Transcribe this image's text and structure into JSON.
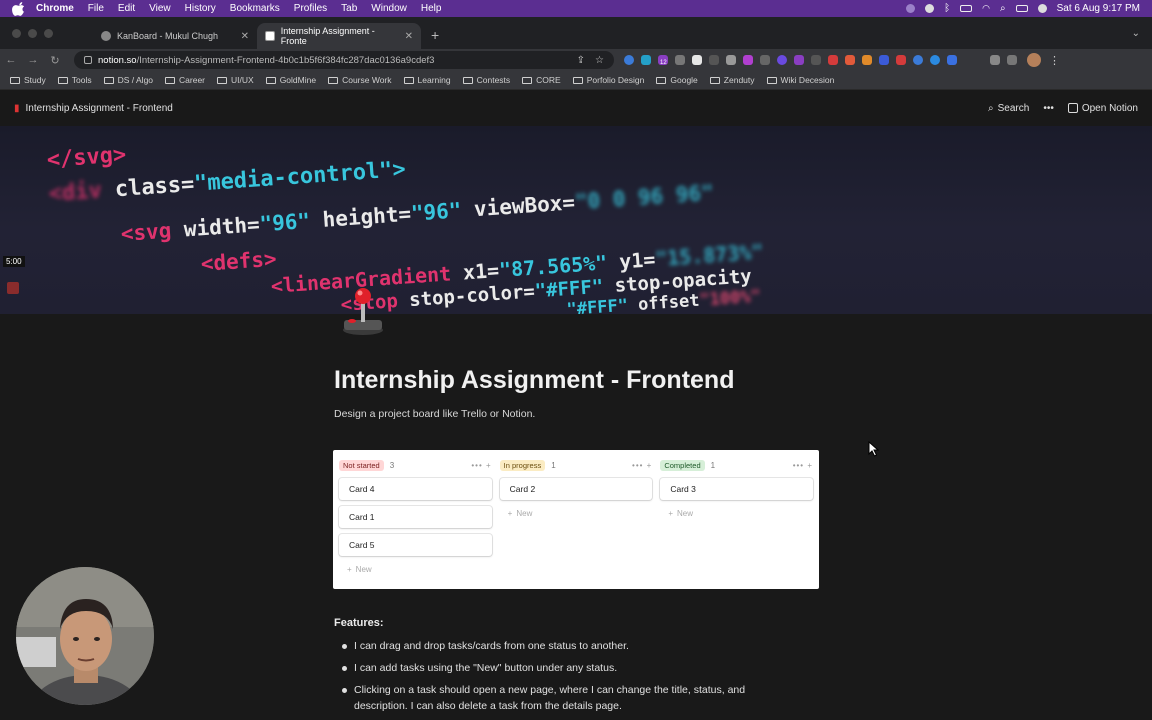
{
  "macos_menubar": {
    "app": "Chrome",
    "items": [
      "File",
      "Edit",
      "View",
      "History",
      "Bookmarks",
      "Profiles",
      "Tab",
      "Window",
      "Help"
    ],
    "datetime": "Sat 6 Aug  9:17 PM"
  },
  "browser": {
    "tabs": [
      {
        "title": "KanBoard - Mukul Chugh",
        "active": false
      },
      {
        "title": "Internship Assignment - Fronte",
        "active": true
      }
    ],
    "url_domain": "notion.so",
    "url_path": "/Internship-Assignment-Frontend-4b0c1b5f6f384fc287dac0136a9cdef3",
    "extension_badge": "12",
    "bookmarks": [
      "Study",
      "Tools",
      "DS / Algo",
      "Career",
      "UI/UX",
      "GoldMine",
      "Course Work",
      "Learning",
      "Contests",
      "CORE",
      "Porfolio Design",
      "Google",
      "Zenduty",
      "Wiki Decesion"
    ]
  },
  "notion_header": {
    "breadcrumb": "Internship Assignment - Frontend",
    "search_label": "Search",
    "more_label": "•••",
    "open_label": "Open Notion"
  },
  "cover_code": {
    "line1": "</svg>",
    "line2a": "<div",
    "line2b": " class=",
    "line2c": "\"media-control\">",
    "line3a": "<svg",
    "line3b": " width=",
    "line3c": "\"96\"",
    "line3d": " height=",
    "line3e": "\"96\"",
    "line3f": " viewBox=",
    "line3g": "\"0 0 96 96\"",
    "line4": "<defs>",
    "line5a": "<linearGradient",
    "line5b": " x1=",
    "line5c": "\"87.565%\"",
    "line5d": " y1=",
    "line5e": "\"15.873%\"",
    "line6a": "<stop",
    "line6b": " stop-color=",
    "line6c": "\"#FFF\"",
    "line6d": " stop-opacity",
    "line7a": "\"#FFF\"",
    "line7b": " offset",
    "line7c": "\"100%\""
  },
  "recording": {
    "timer": "5:00"
  },
  "page": {
    "title": "Internship Assignment - Frontend",
    "description": "Design a project board like Trello or Notion.",
    "board": {
      "columns": [
        {
          "status": "Not started",
          "count": "3",
          "color": "#ffd6d6",
          "cards": [
            "Card 4",
            "Card 1",
            "Card 5"
          ],
          "new_label": "New"
        },
        {
          "status": "In progress",
          "count": "1",
          "color": "#fbecc3",
          "cards": [
            "Card 2"
          ],
          "new_label": "New"
        },
        {
          "status": "Completed",
          "count": "1",
          "color": "#d6efd8",
          "cards": [
            "Card 3"
          ],
          "new_label": "New"
        }
      ],
      "actions_label": "•••",
      "add_label": "+"
    },
    "features_heading": "Features:",
    "features": [
      "I can drag and drop tasks/cards from one status to another.",
      "I can add tasks using the \"New\" button under any status.",
      "Clicking on a task should open a new page, where I can change the title, status, and description. I can also delete a task from the details page."
    ]
  }
}
